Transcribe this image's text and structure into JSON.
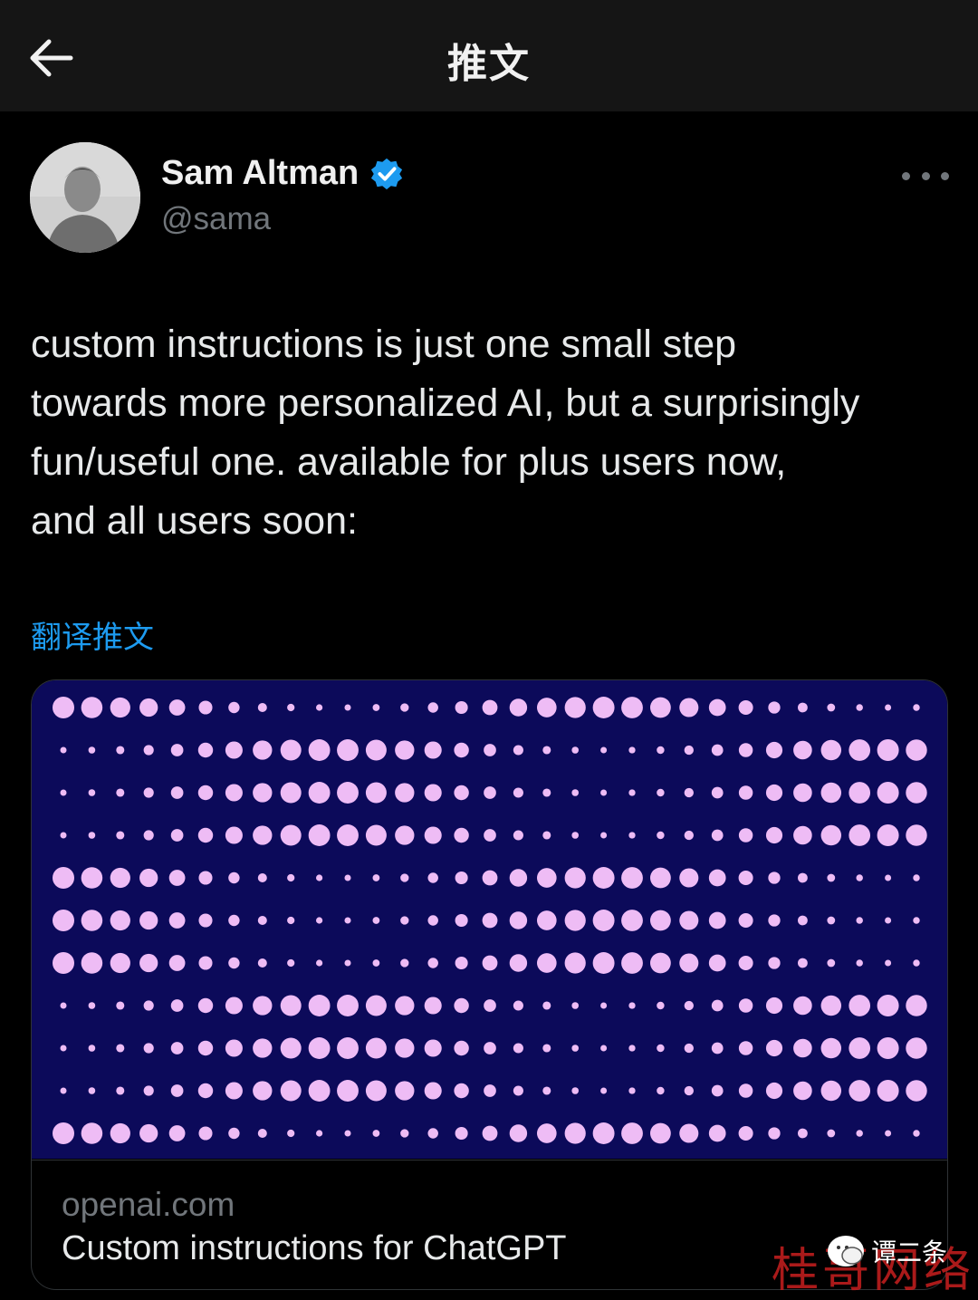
{
  "header": {
    "title": "推文",
    "back_icon": "arrow-left-icon"
  },
  "author": {
    "name": "Sam Altman",
    "handle": "@sama",
    "verified": true,
    "verified_color": "#1d9bf0"
  },
  "tweet": {
    "lines": [
      "custom instructions is just one small step",
      "towards more personalized AI, but a surprisingly",
      "fun/useful one. available for plus users now,",
      "and all users soon:"
    ],
    "translate_label": "翻译推文"
  },
  "link_card": {
    "domain": "openai.com",
    "title": "Custom instructions for ChatGPT",
    "image_bg": "#0c0a5a",
    "dot_color": "#eebcf5"
  },
  "overlay": {
    "wechat_label": "谭二条",
    "watermark": "桂哥网络"
  },
  "colors": {
    "accent": "#1d9bf0",
    "background": "#000000",
    "topbar": "#151515"
  }
}
